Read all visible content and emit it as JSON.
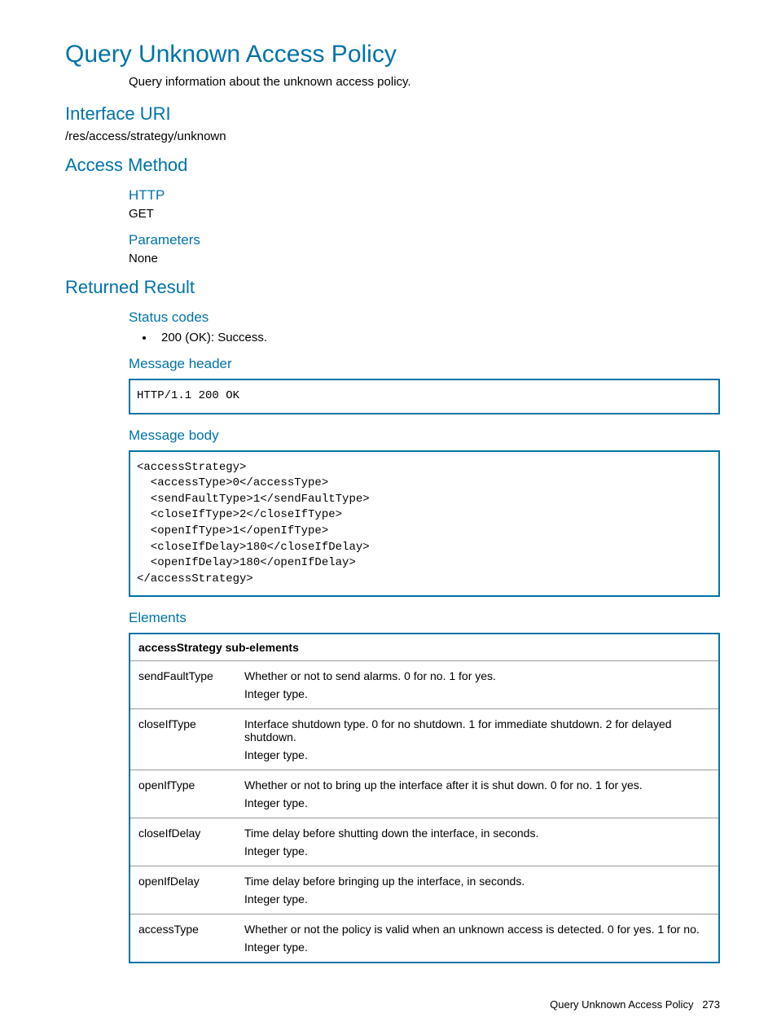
{
  "title": "Query Unknown Access Policy",
  "description": "Query information about the unknown access policy.",
  "h_interface_uri": "Interface URI",
  "interface_uri": "/res/access/strategy/unknown",
  "h_access_method": "Access Method",
  "h_http": "HTTP",
  "http_method": "GET",
  "h_parameters": "Parameters",
  "parameters": "None",
  "h_returned": "Returned Result",
  "h_status_codes": "Status codes",
  "status_code_item": "200 (OK): Success.",
  "h_msg_header": "Message header",
  "msg_header_code": "HTTP/1.1 200 OK",
  "h_msg_body": "Message body",
  "msg_body_code": "<accessStrategy>\n  <accessType>0</accessType>\n  <sendFaultType>1</sendFaultType>\n  <closeIfType>2</closeIfType>\n  <openIfType>1</openIfType>\n  <closeIfDelay>180</closeIfDelay>\n  <openIfDelay>180</openIfDelay>\n</accessStrategy>",
  "h_elements": "Elements",
  "table_header": "accessStrategy sub-elements",
  "rows": [
    {
      "name": "sendFaultType",
      "desc": "Whether or not to send alarms. 0 for no. 1 for yes.",
      "type": "Integer type."
    },
    {
      "name": "closeIfType",
      "desc": "Interface shutdown type. 0 for no shutdown. 1 for immediate shutdown. 2 for delayed shutdown.",
      "type": "Integer type."
    },
    {
      "name": "openIfType",
      "desc": "Whether or not to bring up the interface after it is shut down. 0 for no. 1 for yes.",
      "type": "Integer type."
    },
    {
      "name": "closeIfDelay",
      "desc": "Time delay before shutting down the interface, in seconds.",
      "type": "Integer type."
    },
    {
      "name": "openIfDelay",
      "desc": "Time delay before bringing up the interface, in seconds.",
      "type": "Integer type."
    },
    {
      "name": "accessType",
      "desc": "Whether or not the policy is valid when an unknown access is detected. 0 for yes. 1 for no.",
      "type": "Integer type."
    }
  ],
  "footer_title": "Query Unknown Access Policy",
  "footer_page": "273"
}
